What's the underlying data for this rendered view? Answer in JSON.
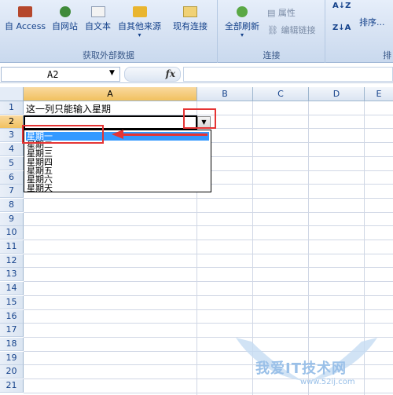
{
  "ribbon": {
    "buttons": {
      "access": "自 Access",
      "web": "自网站",
      "text": "自文本",
      "other": "自其他来源",
      "existing": "现有连接",
      "refresh": "全部刷新",
      "properties": "属性",
      "edit_links": "编辑链接",
      "sort": "排序..."
    },
    "groups": {
      "external": "获取外部数据",
      "connections": "连接",
      "sort_partial": "排"
    }
  },
  "formula_bar": {
    "name_box": "A2",
    "fx": "fx",
    "formula": ""
  },
  "grid": {
    "columns": [
      "A",
      "B",
      "C",
      "D",
      "E"
    ],
    "rows": [
      "1",
      "2",
      "3",
      "4",
      "5",
      "6",
      "7",
      "8",
      "9",
      "10",
      "11",
      "12",
      "13",
      "14",
      "15",
      "16",
      "17",
      "18",
      "19",
      "20",
      "21"
    ],
    "cells": {
      "A1": "这一列只能输入星期"
    }
  },
  "dropdown": {
    "items": [
      "星期一",
      "星期二",
      "星期三",
      "星期四",
      "星期五",
      "星期六",
      "星期天"
    ]
  },
  "watermark": {
    "text": "我爱IT技术网",
    "url": "www.52ij.com"
  },
  "colors": {
    "highlight": "#3399ff",
    "annotation": "#e53434",
    "header_selected": "#f1c15f"
  }
}
